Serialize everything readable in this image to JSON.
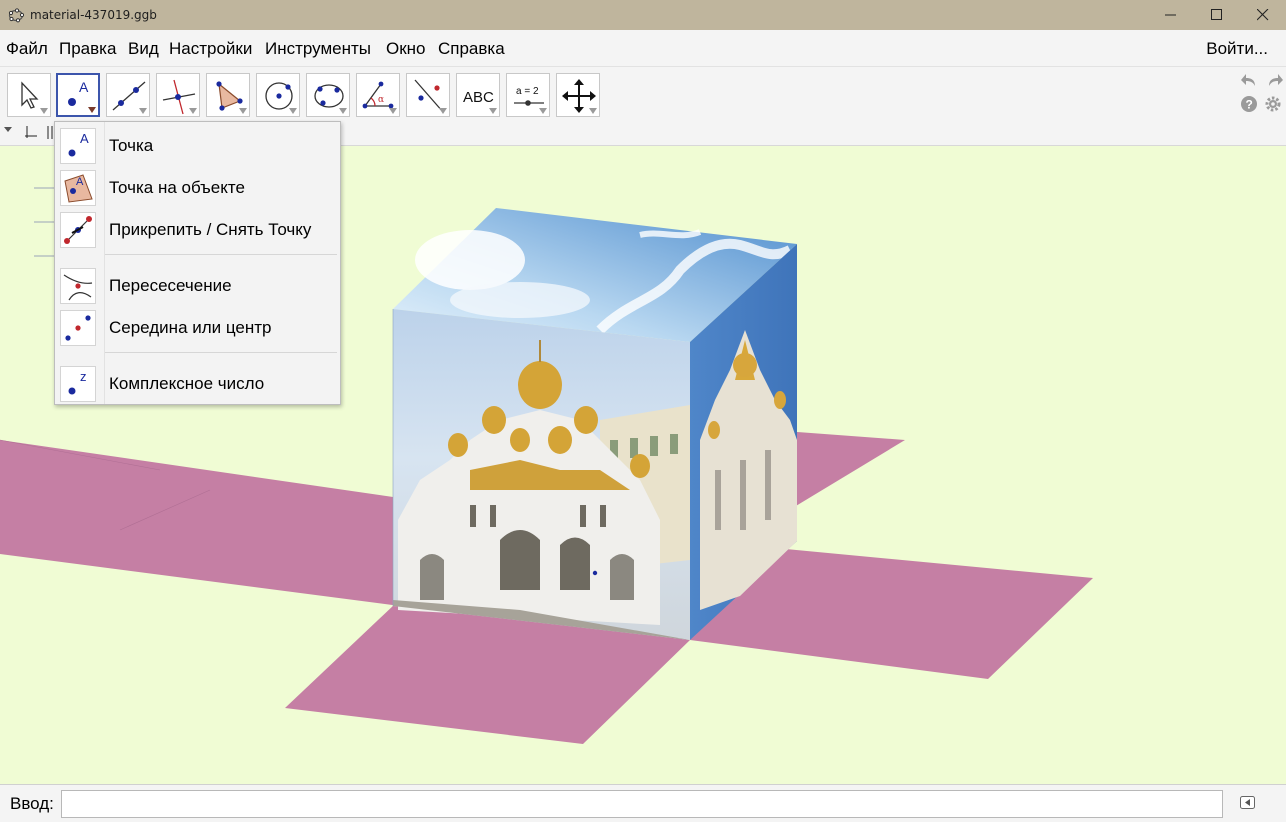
{
  "window": {
    "title": "material-437019.ggb"
  },
  "menu": {
    "items": [
      "Файл",
      "Правка",
      "Вид",
      "Настройки",
      "Инструменты",
      "Окно",
      "Справка"
    ],
    "login": "Войти..."
  },
  "toolbar": {
    "tools": [
      {
        "icon": "move-pointer-icon",
        "active": false
      },
      {
        "icon": "point-icon",
        "active": true
      },
      {
        "icon": "line-icon",
        "active": false
      },
      {
        "icon": "perpendicular-line-icon",
        "active": false
      },
      {
        "icon": "polygon-icon",
        "active": false
      },
      {
        "icon": "circle-icon",
        "active": false
      },
      {
        "icon": "conic-icon",
        "active": false
      },
      {
        "icon": "angle-icon",
        "active": false
      },
      {
        "icon": "reflect-icon",
        "active": false
      },
      {
        "icon": "text-icon",
        "active": false
      },
      {
        "icon": "slider-icon",
        "active": false
      },
      {
        "icon": "move-view-icon",
        "active": false
      }
    ],
    "text_tool_label": "ABC",
    "slider_tool_label": "a = 2"
  },
  "point_menu": {
    "items": [
      {
        "label": "Точка",
        "icon": "point-icon"
      },
      {
        "label": "Точка на объекте",
        "icon": "point-on-object-icon"
      },
      {
        "label": "Прикрепить / Снять Точку",
        "icon": "attach-detach-point-icon"
      },
      {
        "label": "Пересесечение",
        "icon": "intersect-icon"
      },
      {
        "label": "Середина или центр",
        "icon": "midpoint-icon"
      },
      {
        "label": "Комплексное число",
        "icon": "complex-number-icon"
      }
    ]
  },
  "input_bar": {
    "label": "Ввод:",
    "value": ""
  },
  "colors": {
    "title_bar": "#bfb59d",
    "graphics_background": "#f0fcd4",
    "cube_net": "#c57fa4",
    "active_tool_border": "#3c55ac",
    "point": "#1a2a9e"
  }
}
